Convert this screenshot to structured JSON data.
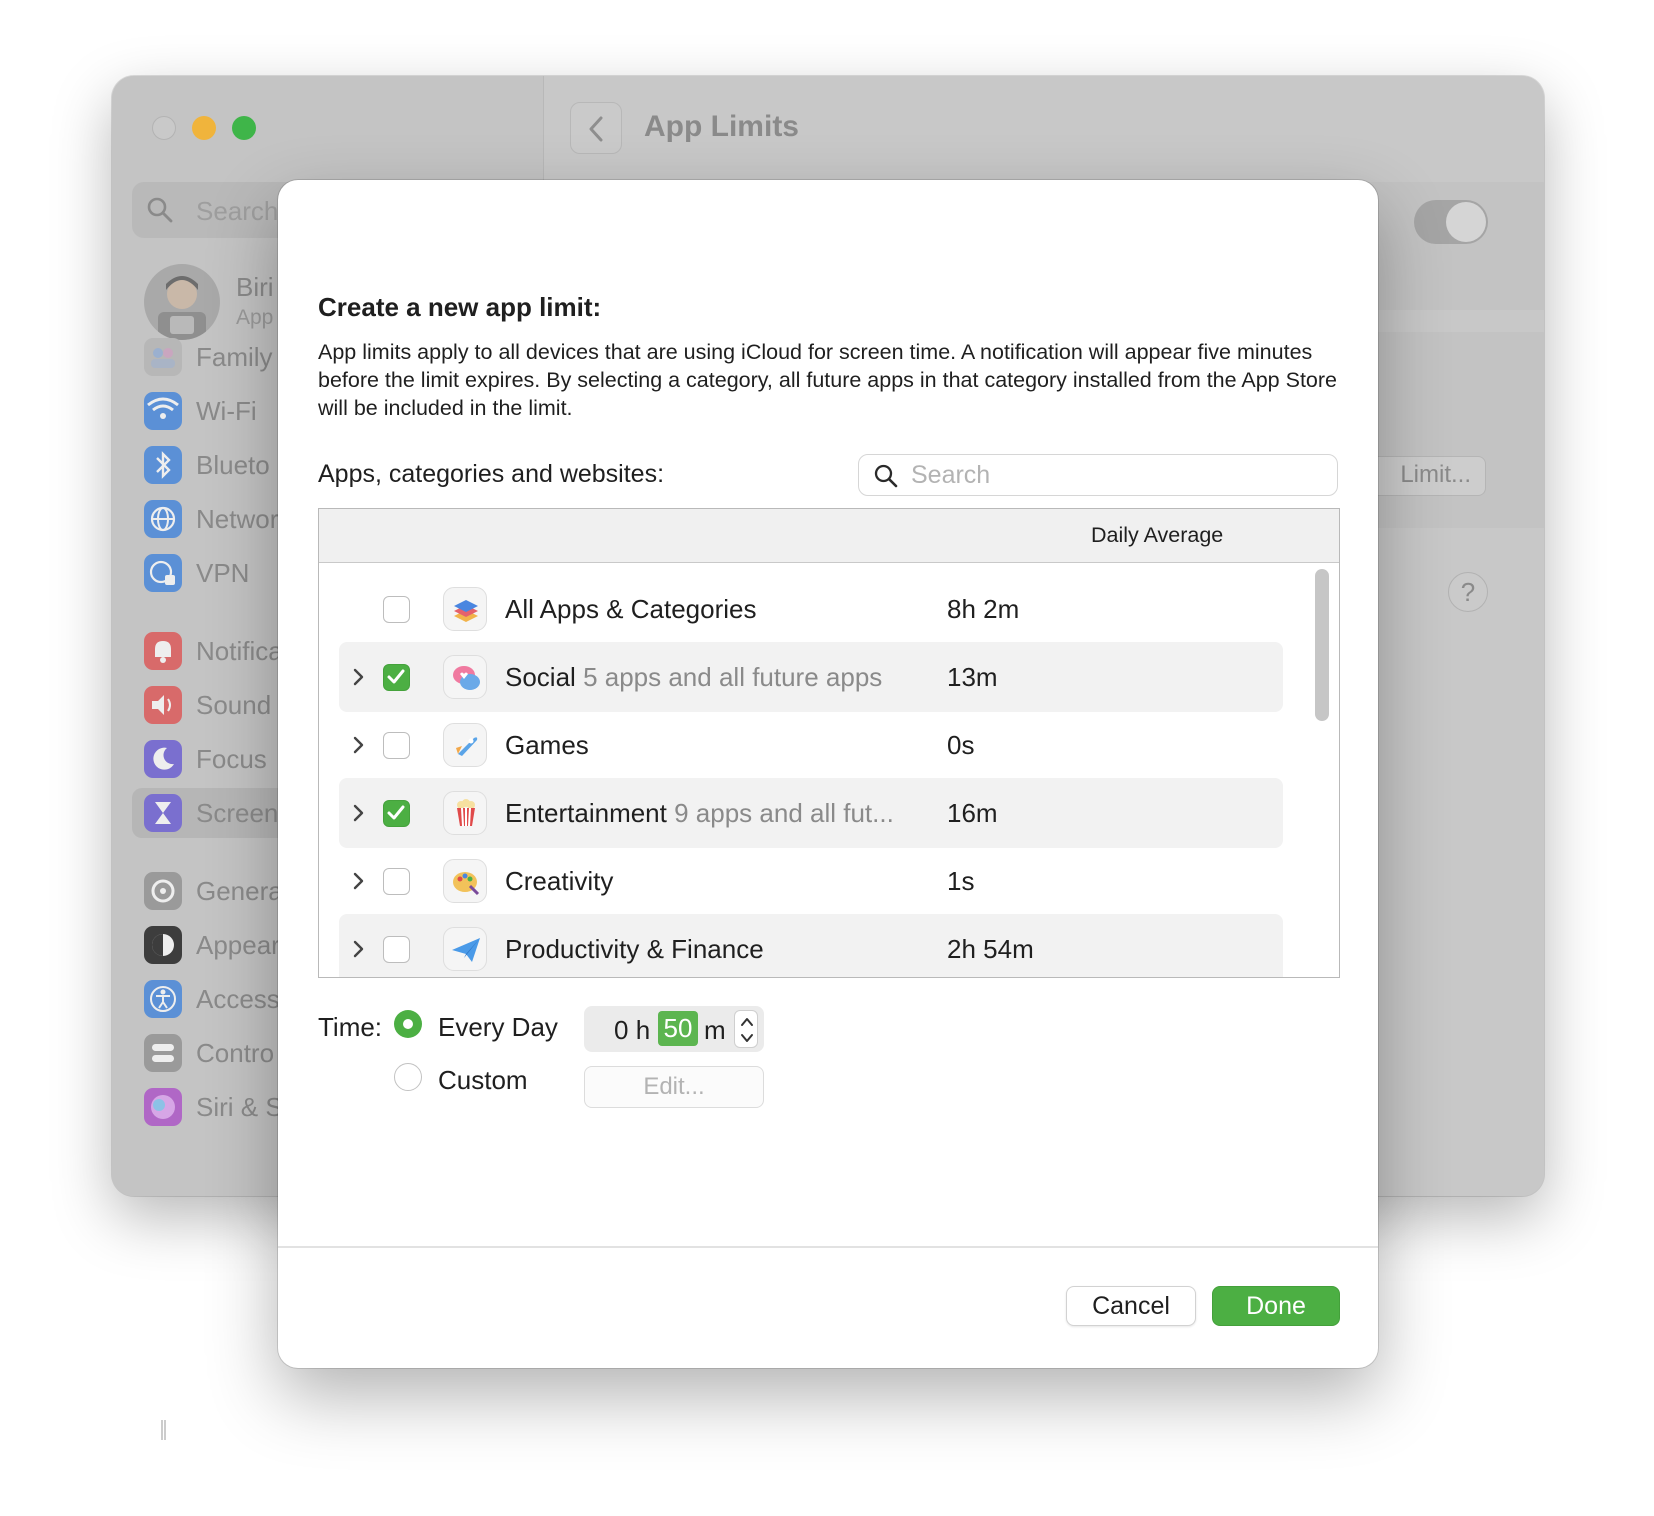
{
  "window": {
    "title": "App Limits",
    "search_placeholder": "Search",
    "profile": {
      "name": "Biri",
      "subtitle": "App"
    },
    "limit_button": "Limit...",
    "help": "?"
  },
  "sidebar": {
    "family": "Family",
    "items": [
      {
        "label": "Wi-Fi",
        "icon": "wifi-icon",
        "color": "#5b90d6"
      },
      {
        "label": "Blueto",
        "icon": "bluetooth-icon",
        "color": "#5b90d6"
      },
      {
        "label": "Networ",
        "icon": "globe-icon",
        "color": "#5b90d6"
      },
      {
        "label": "VPN",
        "icon": "vpn-icon",
        "color": "#5b90d6"
      },
      {
        "label": "Notifica",
        "icon": "bell-icon",
        "color": "#d86a6a"
      },
      {
        "label": "Sound",
        "icon": "speaker-icon",
        "color": "#d86a6a"
      },
      {
        "label": "Focus",
        "icon": "moon-icon",
        "color": "#7a6fcf"
      },
      {
        "label": "Screen",
        "icon": "hourglass-icon",
        "color": "#7a6fcf"
      },
      {
        "label": "Genera",
        "icon": "gear-icon",
        "color": "#9a9a9a"
      },
      {
        "label": "Appear",
        "icon": "appearance-icon",
        "color": "#3d3d3d"
      },
      {
        "label": "Access",
        "icon": "accessibility-icon",
        "color": "#5b90d6"
      },
      {
        "label": "Contro",
        "icon": "control-center-icon",
        "color": "#9a9a9a"
      },
      {
        "label": "Siri & S",
        "icon": "siri-icon",
        "color": "#b067c6"
      }
    ]
  },
  "sheet": {
    "title": "Create a new app limit:",
    "description": "App limits apply to all devices that are using iCloud for screen time. A notification will appear five minutes before the limit expires. By selecting a category, all future apps in that category installed from the App Store will be included in the limit.",
    "list_label": "Apps, categories and websites:",
    "search_placeholder": "Search",
    "column_header": "Daily Average",
    "rows": [
      {
        "name": "All Apps & Categories",
        "sub": "",
        "avg": "8h 2m",
        "checked": false,
        "expandable": false
      },
      {
        "name": "Social",
        "sub": "5 apps and all future apps",
        "avg": "13m",
        "checked": true,
        "expandable": true
      },
      {
        "name": "Games",
        "sub": "",
        "avg": "0s",
        "checked": false,
        "expandable": true
      },
      {
        "name": "Entertainment",
        "sub": "9 apps and all fut...",
        "avg": "16m",
        "checked": true,
        "expandable": true
      },
      {
        "name": "Creativity",
        "sub": "",
        "avg": "1s",
        "checked": false,
        "expandable": true
      },
      {
        "name": "Productivity & Finance",
        "sub": "",
        "avg": "2h 54m",
        "checked": false,
        "expandable": true
      }
    ],
    "time_label": "Time:",
    "every_day": "Every Day",
    "custom": "Custom",
    "hours": "0",
    "hours_unit": "h",
    "minutes": "50",
    "minutes_unit": "m",
    "edit": "Edit...",
    "cancel": "Cancel",
    "done": "Done"
  },
  "colors": {
    "accent": "#4caf43"
  }
}
